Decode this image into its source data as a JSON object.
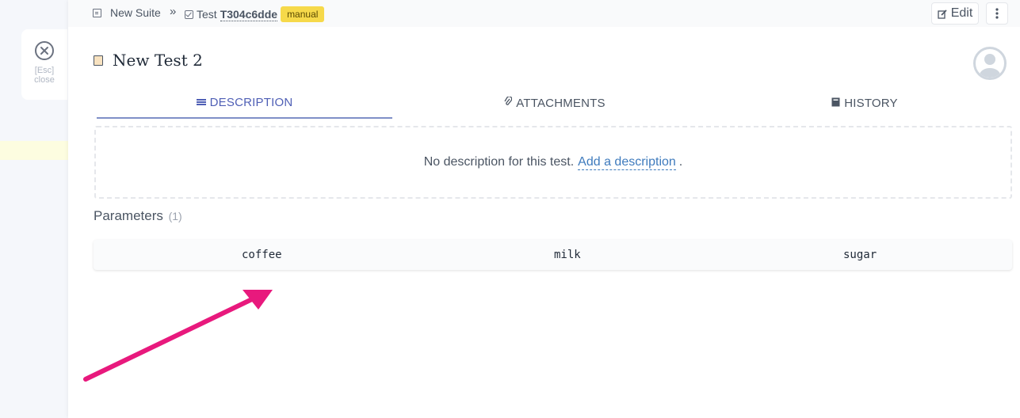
{
  "close": {
    "key_hint": "[Esc]",
    "label": "close"
  },
  "breadcrumb": {
    "suite_label": "New Suite",
    "separator": "»",
    "test_prefix": "Test",
    "test_id": "T304c6dde",
    "badge": "manual"
  },
  "toolbar": {
    "edit_label": "Edit"
  },
  "test": {
    "title": "New Test 2"
  },
  "tabs": [
    {
      "label": "DESCRIPTION",
      "icon": "list-icon",
      "active": true
    },
    {
      "label": "ATTACHMENTS",
      "icon": "paperclip-icon",
      "active": false
    },
    {
      "label": "HISTORY",
      "icon": "book-icon",
      "active": false
    }
  ],
  "description": {
    "empty_text": "No description for this test.",
    "add_link": "Add a description",
    "trailing": "."
  },
  "parameters": {
    "heading": "Parameters",
    "count": "(1)",
    "columns": [
      "coffee",
      "milk",
      "sugar"
    ]
  },
  "colors": {
    "accent": "#4f5fb5",
    "badge": "#f6d94a",
    "link": "#3f7bbd",
    "annotation_arrow": "#e8197d"
  }
}
